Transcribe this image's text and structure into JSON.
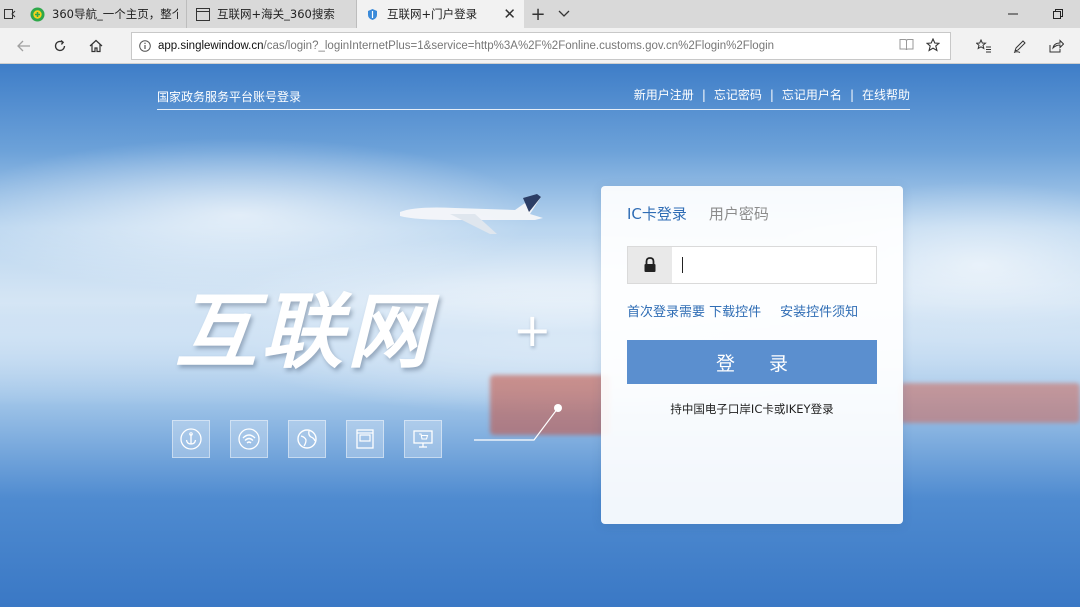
{
  "browser": {
    "tabs": [
      {
        "title": "360导航_一个主页，整个世",
        "icon": "360-nav-icon",
        "active": false
      },
      {
        "title": "互联网+海关_360搜索",
        "icon": "page-icon",
        "active": false
      },
      {
        "title": "互联网+门户登录",
        "icon": "shield-site-icon",
        "active": true
      }
    ],
    "address": {
      "host": "app.singlewindow.cn",
      "path": "/cas/login?_loginInternetPlus=1&service=http%3A%2F%2Fonline.customs.gov.cn%2Flogin%2Flogin"
    }
  },
  "page": {
    "portal_title": "国家政务服务平台账号登录",
    "top_links": [
      "新用户注册",
      "忘记密码",
      "忘记用户名",
      "在线帮助"
    ],
    "link_separator": "|",
    "hero_title": "互联网",
    "hero_plus": "+",
    "service_icons": [
      "anchor-icon",
      "wifi-icon",
      "globe-icon",
      "frame-icon",
      "monitor-cart-icon"
    ]
  },
  "login": {
    "tabs": [
      "IC卡登录",
      "用户密码"
    ],
    "pin_value": "",
    "help_links": [
      "首次登录需要 下载控件",
      "安装控件须知"
    ],
    "login_button": "登 录",
    "note": "持中国电子口岸IC卡或IKEY登录"
  },
  "colors": {
    "accent": "#2f6db5",
    "button": "#5b8fcf",
    "page_blue": "#3d7fc8"
  }
}
